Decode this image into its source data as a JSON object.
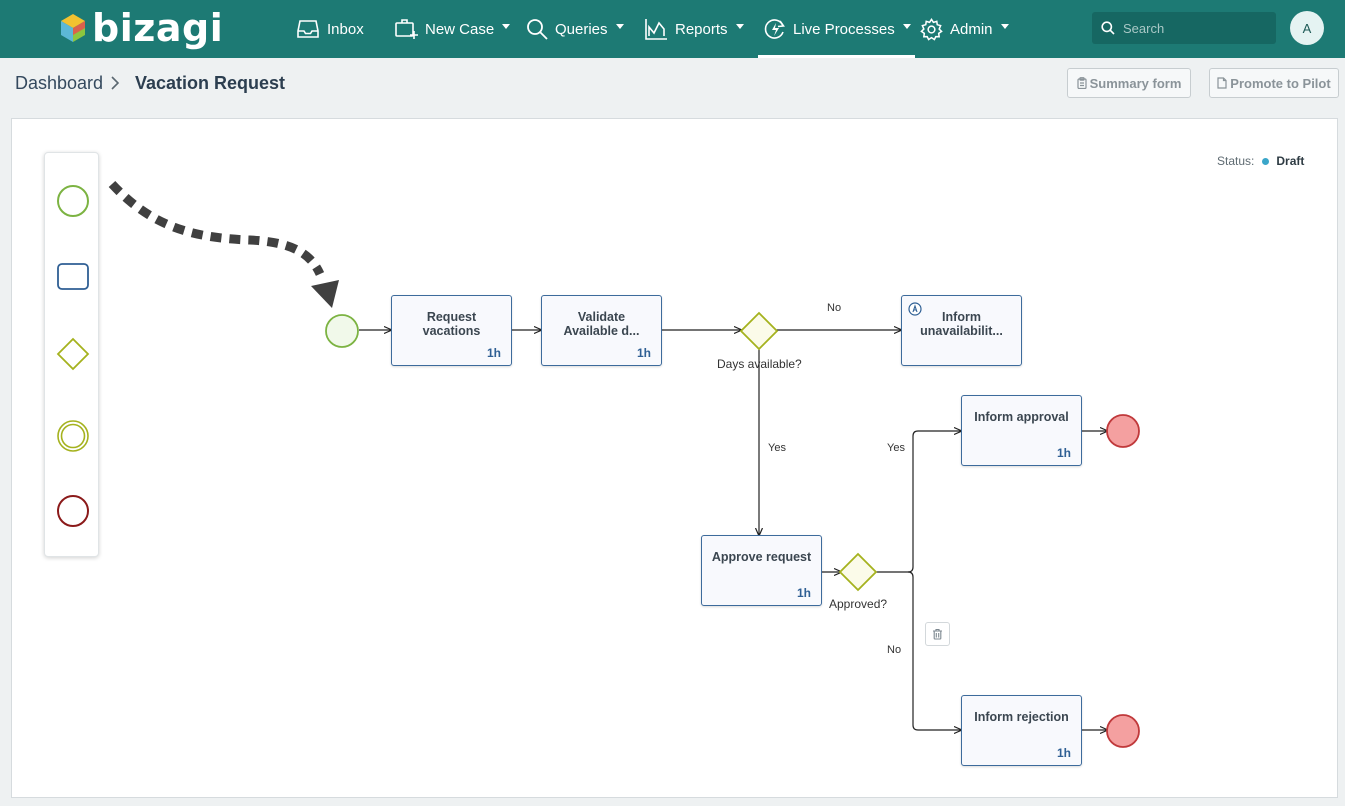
{
  "app": {
    "logo_text": "bizagi"
  },
  "nav": {
    "inbox": "Inbox",
    "new_case": "New Case",
    "queries": "Queries",
    "reports": "Reports",
    "live_processes": "Live Processes",
    "admin": "Admin"
  },
  "search": {
    "placeholder": "Search"
  },
  "user": {
    "initial": "A"
  },
  "breadcrumb": {
    "root": "Dashboard",
    "current": "Vacation Request"
  },
  "actions": {
    "summary_form": "Summary form",
    "promote_to_pilot": "Promote to Pilot"
  },
  "status": {
    "label": "Status:",
    "value": "Draft"
  },
  "palette": {
    "items": [
      "start-event-icon",
      "task-icon",
      "gateway-icon",
      "intermediate-event-icon",
      "end-event-icon"
    ]
  },
  "process": {
    "tasks": {
      "request_vacations": {
        "name": "Request vacations",
        "duration": "1h"
      },
      "validate_available": {
        "name": "Validate Available d...",
        "duration": "1h"
      },
      "inform_unavailability": {
        "name": "Inform unavailabilit..."
      },
      "approve_request": {
        "name": "Approve request",
        "duration": "1h"
      },
      "inform_approval": {
        "name": "Inform approval",
        "duration": "1h"
      },
      "inform_rejection": {
        "name": "Inform rejection",
        "duration": "1h"
      }
    },
    "gateways": {
      "days_available": "Days available?",
      "approved": "Approved?"
    },
    "flows": {
      "days_no": "No",
      "days_yes": "Yes",
      "approved_yes": "Yes",
      "approved_no": "No"
    }
  },
  "colors": {
    "header": "#1d7a74",
    "start_event": "#7cb342",
    "gateway": "#a5b21e",
    "end_event_fill": "#f4a0a0",
    "end_event_stroke": "#c0393b",
    "task_border": "#3d6b9c"
  }
}
